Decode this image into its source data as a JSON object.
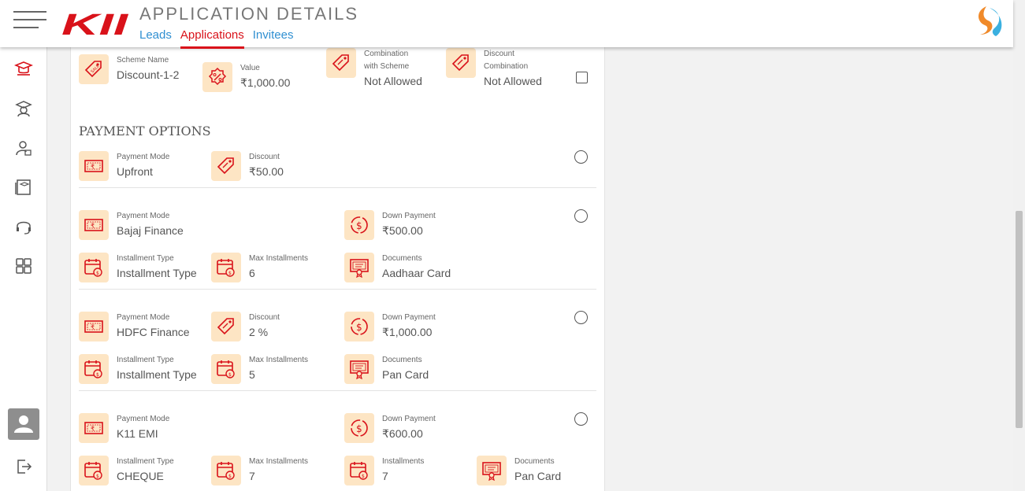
{
  "header": {
    "logo_text": "KII",
    "title": "APPLICATION DETAILS",
    "tabs": [
      "Leads",
      "Applications",
      "Invitees"
    ]
  },
  "colors": {
    "accent": "#d9121a",
    "link": "#2f8fd1",
    "icon_bg": "#fde5c4"
  },
  "scheme": {
    "name_label": "Scheme Name",
    "name_value": "Discount-1-2",
    "value_label": "Value",
    "value_value": "₹1,000.00",
    "combo_scheme_label": "Combination with Scheme",
    "combo_scheme_value": "Not Allowed",
    "combo_discount_label": "Discount Combination",
    "combo_discount_value": "Not Allowed"
  },
  "payment_options_title": "PAYMENT OPTIONS",
  "options": [
    {
      "mode_label": "Payment Mode",
      "mode": "Upfront",
      "discount_label": "Discount",
      "discount": "₹50.00"
    },
    {
      "mode_label": "Payment Mode",
      "mode": "Bajaj Finance",
      "down_label": "Down Payment",
      "down": "₹500.00",
      "itype_label": "Installment Type",
      "itype": "Installment Type",
      "max_label": "Max Installments",
      "max": "6",
      "docs_label": "Documents",
      "docs": "Aadhaar Card"
    },
    {
      "mode_label": "Payment Mode",
      "mode": "HDFC Finance",
      "discount_label": "Discount",
      "discount": "2 %",
      "down_label": "Down Payment",
      "down": "₹1,000.00",
      "itype_label": "Installment Type",
      "itype": "Installment Type",
      "max_label": "Max Installments",
      "max": "5",
      "docs_label": "Documents",
      "docs": "Pan Card"
    },
    {
      "mode_label": "Payment Mode",
      "mode": "K11 EMI",
      "down_label": "Down Payment",
      "down": "₹600.00",
      "itype_label": "Installment Type",
      "itype": "CHEQUE",
      "max_label": "Max Installments",
      "max": "7",
      "inst_label": "Installments",
      "inst": "7",
      "docs_label": "Documents",
      "docs": "Pan Card"
    }
  ]
}
